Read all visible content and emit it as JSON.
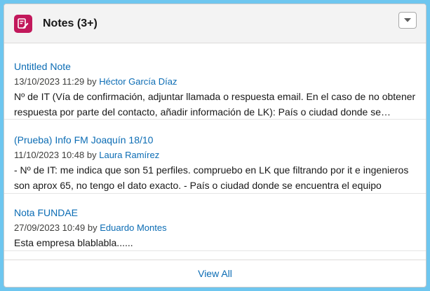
{
  "header": {
    "title": "Notes (3+)",
    "icon": "note-edit-icon",
    "icon_color": "#c2185b",
    "menu_icon": "chevron-down-icon"
  },
  "notes": [
    {
      "title": "Untitled Note",
      "date": "13/10/2023 11:29",
      "by": "by",
      "author": "Héctor García Díaz",
      "body": "Nº de IT (Vía de confirmación, adjuntar llamada o respuesta email. En el caso de no obtener respuesta por parte del contacto, añadir información de LK): País o ciudad donde se encuentra"
    },
    {
      "title": "(Prueba) Info FM Joaquín 18/10",
      "date": "11/10/2023 10:48",
      "by": "by",
      "author": "Laura Ramírez",
      "body": "- Nº de IT: me indica que son 51 perfiles. compruebo en LK que filtrando por it e ingenieros son aprox 65, no tengo el dato exacto. - País o ciudad donde se encuentra el equipo"
    },
    {
      "title": "Nota FUNDAE",
      "date": "27/09/2023 10:49",
      "by": "by",
      "author": "Eduardo Montes",
      "body": "Esta empresa blablabla......"
    }
  ],
  "footer": {
    "view_all": "View All"
  },
  "colors": {
    "link": "#0b6cb4",
    "background": "#6ec6ef"
  }
}
